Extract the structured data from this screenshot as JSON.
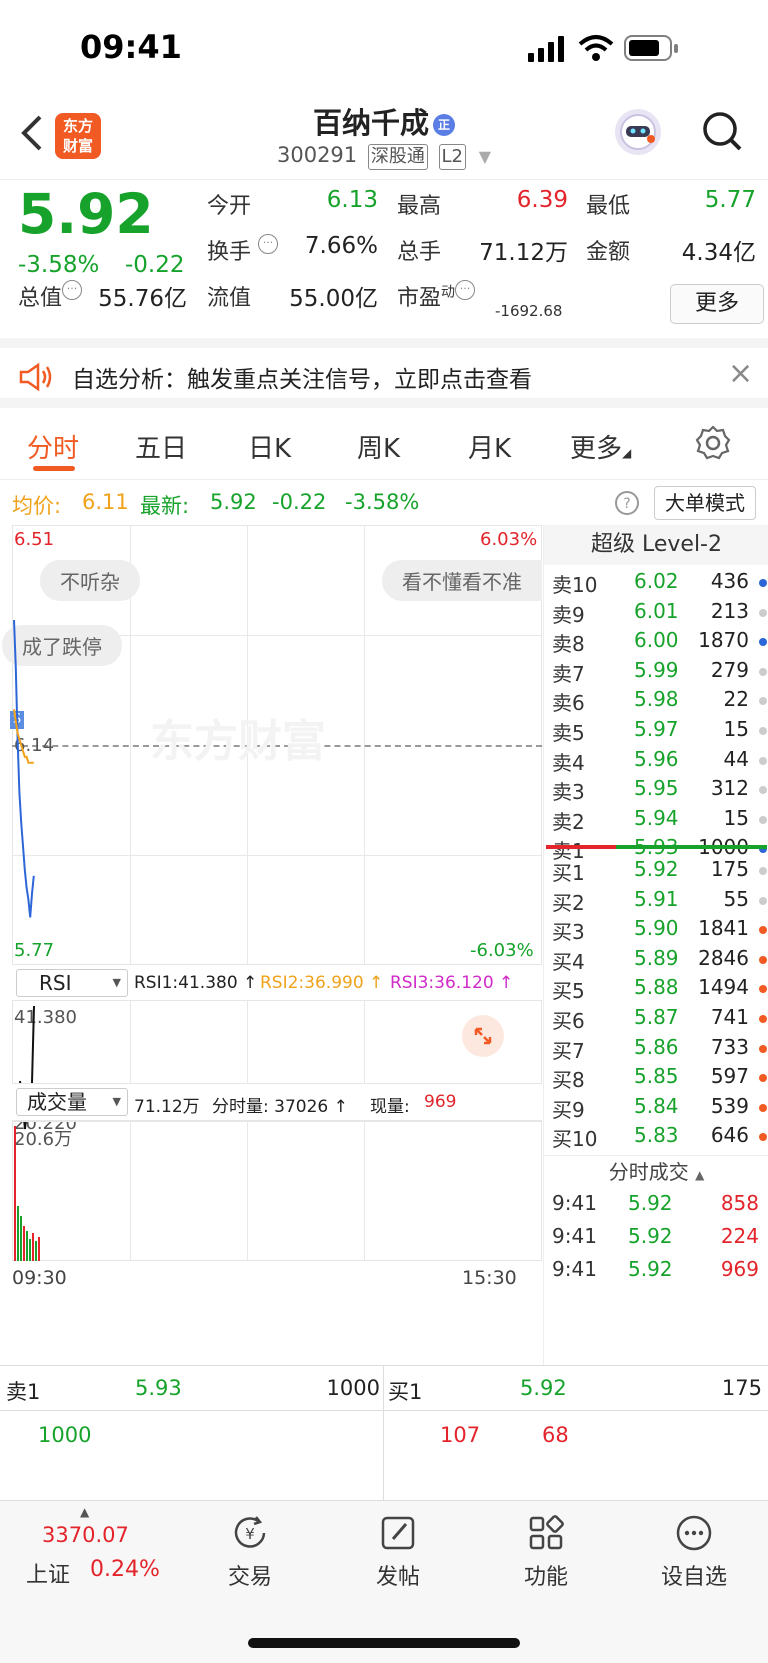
{
  "status": {
    "time": "09:41"
  },
  "header": {
    "back_icon": "chevron-left-icon",
    "logo_text": "东方财富",
    "stock_name": "百纳千成",
    "reg_badge": "正",
    "code": "300291",
    "tag1": "深股通",
    "tag2": "L2"
  },
  "quote": {
    "price": "5.92",
    "pct": "-3.58%",
    "chg": "-0.22",
    "labels": {
      "open": "今开",
      "high": "最高",
      "low": "最低",
      "turnover": "换手",
      "volume": "总手",
      "amount": "金额",
      "mcap": "总值",
      "float": "流值",
      "pe": "市盈",
      "pe_sup": "动"
    },
    "values": {
      "open": "6.13",
      "high": "6.39",
      "low": "5.77",
      "turnover": "7.66%",
      "volume": "71.12万",
      "amount": "4.34亿",
      "mcap": "55.76亿",
      "float": "55.00亿",
      "pe": "-1692.68"
    },
    "more_btn": "更多"
  },
  "notice": {
    "text": "自选分析：触发重点关注信号，立即点击查看",
    "close": "×"
  },
  "tabs": [
    "分时",
    "五日",
    "日K",
    "周K",
    "月K",
    "更多"
  ],
  "info": {
    "avg_label": "均价:",
    "avg": "6.11",
    "last_label": "最新:",
    "last": "5.92",
    "chg": "-0.22",
    "pct": "-3.58%",
    "bigorder_btn": "大单模式"
  },
  "chart": {
    "top_price": "6.51",
    "top_pct": "6.03%",
    "mid_price": "6.14",
    "bottom_price": "5.77",
    "bottom_pct": "-6.03%",
    "bubbles": [
      "不听杂",
      "看不懂看不准",
      "成了跌停"
    ],
    "watermark": "东方财富",
    "rsi": {
      "selector": "RSI",
      "r1": "RSI1:41.380 ↑",
      "r2": "RSI2:36.990 ↑",
      "r3": "RSI3:36.120 ↑",
      "top": "41.380",
      "bottom": "20.220"
    },
    "vol": {
      "selector": "成交量",
      "total": "71.12万",
      "fenshi": "分时量: 37026 ↑",
      "now_label": "现量:",
      "now": "969",
      "top": "20.6万"
    },
    "time_start": "09:30",
    "time_end": "15:30"
  },
  "chart_data": {
    "type": "line",
    "x": [
      "09:30",
      "09:31",
      "09:32",
      "09:33",
      "09:34",
      "09:35",
      "09:36",
      "09:37",
      "09:38",
      "09:39",
      "09:40",
      "09:41"
    ],
    "series": [
      {
        "values": [
          6.35,
          6.27,
          6.15,
          6.06,
          6.01,
          5.97,
          5.93,
          5.9,
          5.88,
          5.85,
          5.89,
          5.92
        ]
      },
      {
        "values": [
          6.2,
          6.18,
          6.16,
          6.15,
          6.14,
          6.13,
          6.12,
          6.12,
          6.11,
          6.11,
          6.11,
          6.11
        ]
      }
    ],
    "ylim": [
      5.77,
      6.51
    ]
  },
  "book": {
    "title": "超级 Level-2",
    "asks": [
      {
        "label": "卖10",
        "price": "6.02",
        "vol": "436",
        "dot": "#2d66d6"
      },
      {
        "label": "卖9",
        "price": "6.01",
        "vol": "213",
        "dot": "#cccccc"
      },
      {
        "label": "卖8",
        "price": "6.00",
        "vol": "1870",
        "dot": "#2d66d6"
      },
      {
        "label": "卖7",
        "price": "5.99",
        "vol": "279",
        "dot": "#cccccc"
      },
      {
        "label": "卖6",
        "price": "5.98",
        "vol": "22",
        "dot": "#cccccc"
      },
      {
        "label": "卖5",
        "price": "5.97",
        "vol": "15",
        "dot": "#cccccc"
      },
      {
        "label": "卖4",
        "price": "5.96",
        "vol": "44",
        "dot": "#cccccc"
      },
      {
        "label": "卖3",
        "price": "5.95",
        "vol": "312",
        "dot": "#cccccc"
      },
      {
        "label": "卖2",
        "price": "5.94",
        "vol": "15",
        "dot": "#cccccc"
      },
      {
        "label": "卖1",
        "price": "5.93",
        "vol": "1000",
        "dot": "#2d66d6"
      }
    ],
    "bids": [
      {
        "label": "买1",
        "price": "5.92",
        "vol": "175",
        "dot": "#cccccc"
      },
      {
        "label": "买2",
        "price": "5.91",
        "vol": "55",
        "dot": "#cccccc"
      },
      {
        "label": "买3",
        "price": "5.90",
        "vol": "1841",
        "dot": "#f15a22"
      },
      {
        "label": "买4",
        "price": "5.89",
        "vol": "2846",
        "dot": "#f15a22"
      },
      {
        "label": "买5",
        "price": "5.88",
        "vol": "1494",
        "dot": "#f15a22"
      },
      {
        "label": "买6",
        "price": "5.87",
        "vol": "741",
        "dot": "#f15a22"
      },
      {
        "label": "买7",
        "price": "5.86",
        "vol": "733",
        "dot": "#f15a22"
      },
      {
        "label": "买8",
        "price": "5.85",
        "vol": "597",
        "dot": "#f15a22"
      },
      {
        "label": "买9",
        "price": "5.84",
        "vol": "539",
        "dot": "#f15a22"
      },
      {
        "label": "买10",
        "price": "5.83",
        "vol": "646",
        "dot": "#f15a22"
      }
    ],
    "trades_title": "分时成交",
    "trades": [
      {
        "time": "9:41",
        "price": "5.92",
        "vol": "858"
      },
      {
        "time": "9:41",
        "price": "5.92",
        "vol": "224"
      },
      {
        "time": "9:41",
        "price": "5.92",
        "vol": "969"
      }
    ]
  },
  "bottom": {
    "ask_label": "卖1",
    "ask_price": "5.93",
    "ask_vol": "1000",
    "bid_label": "买1",
    "bid_price": "5.92",
    "bid_vol": "175",
    "row2_left": "1000",
    "row2_mid": "107",
    "row2_right": "68"
  },
  "toolbar": {
    "index_value": "3370.07",
    "index_name": "上证",
    "index_pct": "0.24%",
    "items": [
      {
        "label": "交易",
        "icon": "trade-icon"
      },
      {
        "label": "发帖",
        "icon": "edit-icon"
      },
      {
        "label": "功能",
        "icon": "grid-icon"
      },
      {
        "label": "设自选",
        "icon": "more-icon"
      }
    ]
  }
}
